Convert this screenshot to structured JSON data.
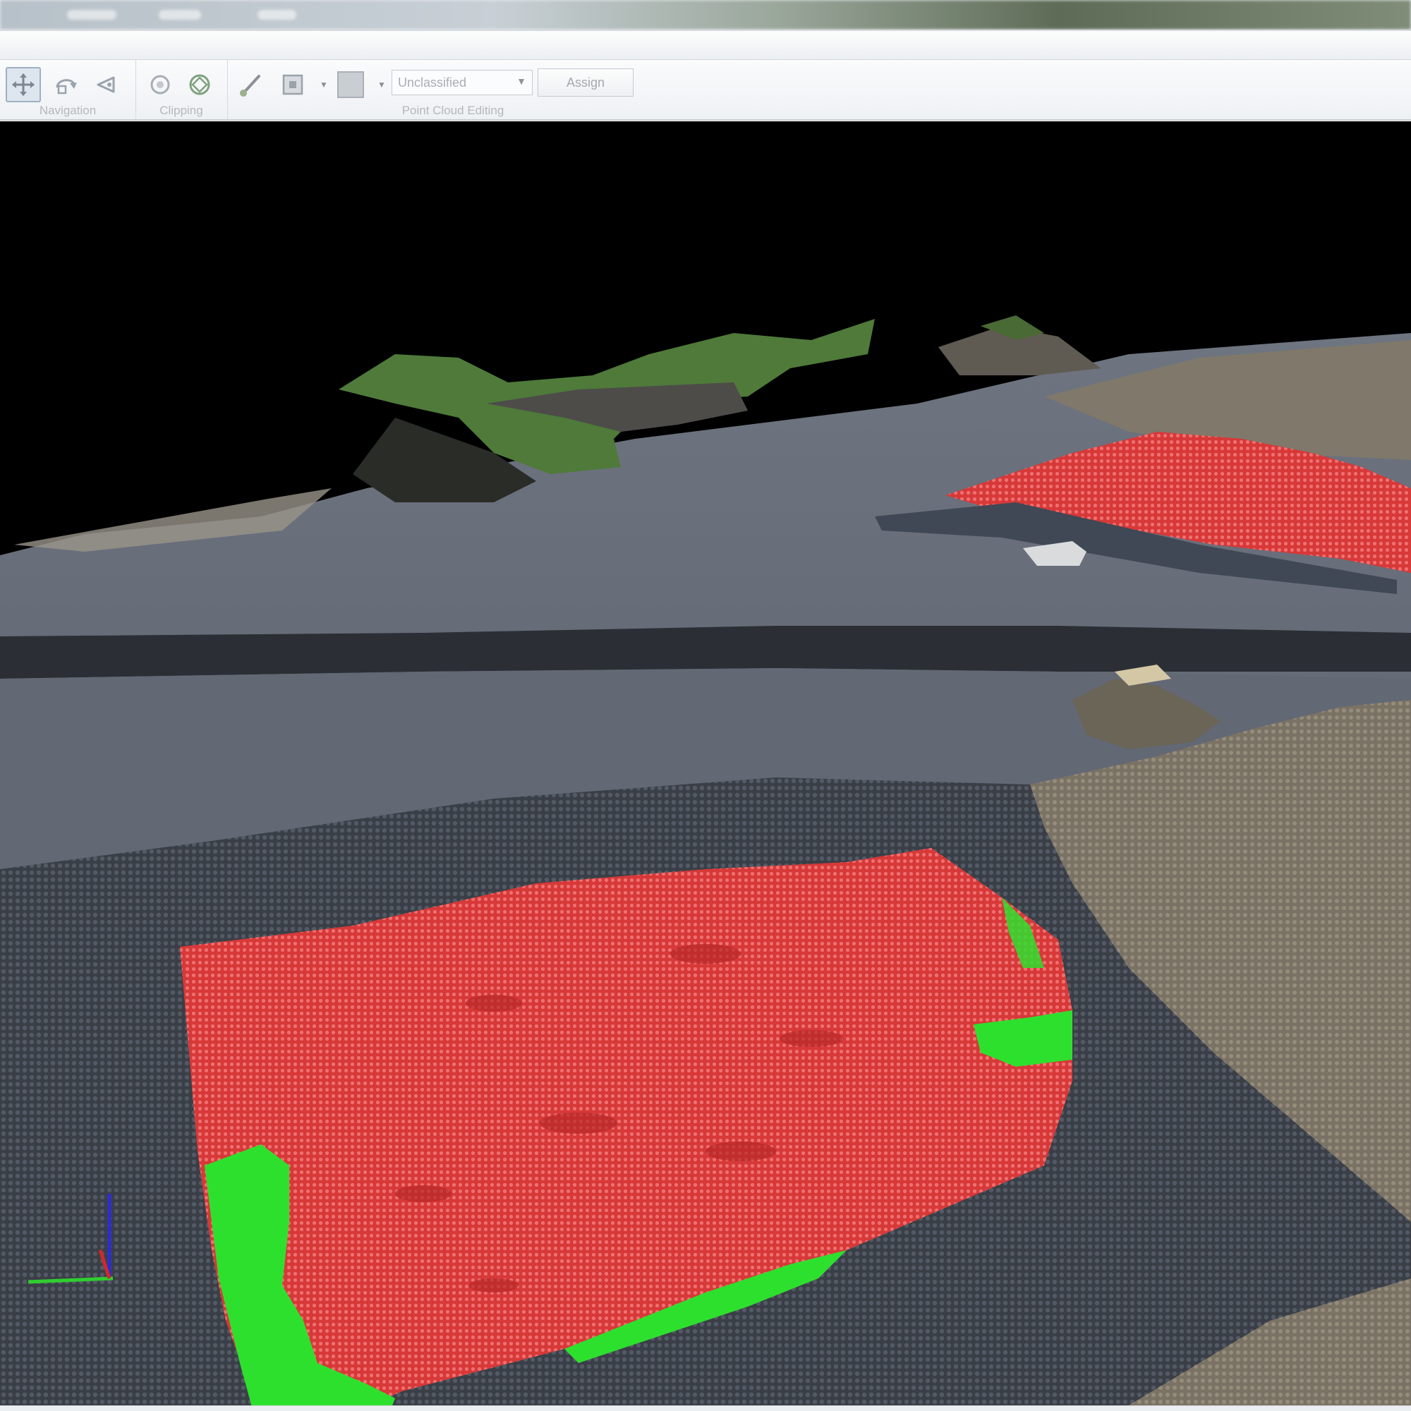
{
  "ribbon": {
    "groups": {
      "navigation": {
        "label": "Navigation"
      },
      "clipping": {
        "label": "Clipping"
      },
      "point_cloud_editing": {
        "label": "Point Cloud Editing"
      }
    },
    "classification_select": {
      "value": "Unclassified"
    },
    "assign_button": {
      "label": "Assign"
    }
  },
  "icons": {
    "navigation": [
      "pan-icon",
      "orbit-icon",
      "look-icon"
    ],
    "clipping": [
      "clip-box-icon",
      "clip-shape-icon"
    ],
    "editing": [
      "brush-icon",
      "select-region-icon",
      "class-color-swatch"
    ]
  },
  "colors": {
    "selection_red": "#e03a3a",
    "classified_green": "#2ee02e",
    "gravel_blue_gray": "#5d6572",
    "sand_tan": "#8a8070",
    "vegetation_green": "#4f7a3a"
  },
  "viewport": {
    "view": "3D point cloud",
    "axis_triad": [
      "x-axis",
      "y-axis",
      "z-axis"
    ]
  }
}
